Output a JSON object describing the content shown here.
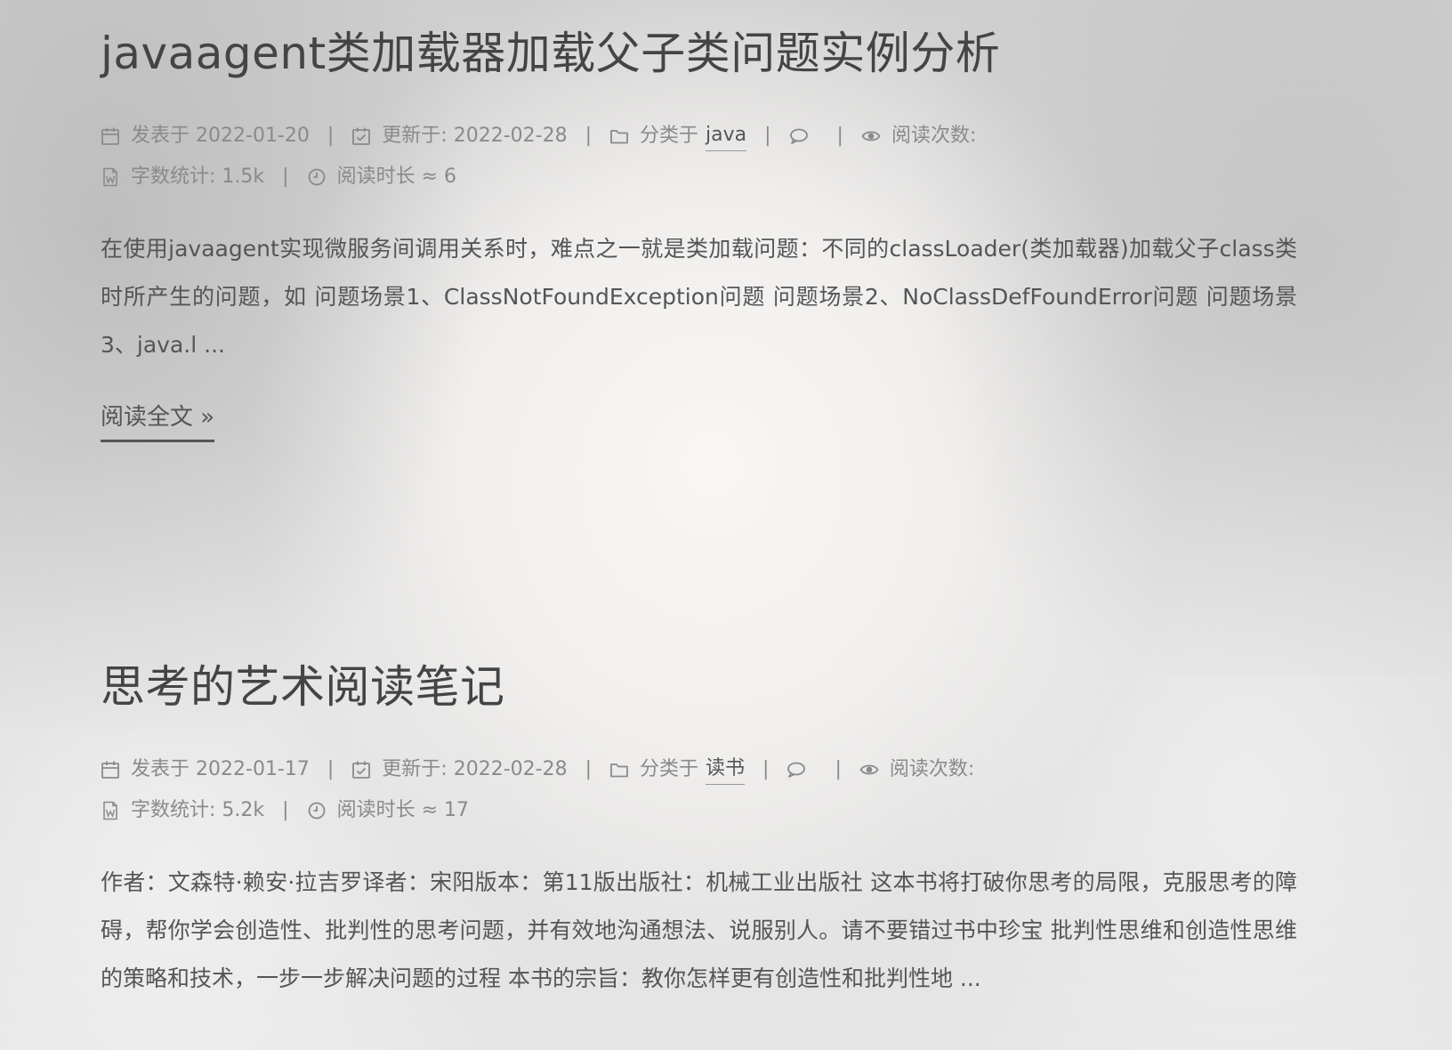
{
  "posts": [
    {
      "title": "javaagent类加载器加载父子类问题实例分析",
      "meta": {
        "posted_label": "发表于",
        "posted_date": "2022-01-20",
        "updated_label": "更新于:",
        "updated_date": "2022-02-28",
        "category_label": "分类于",
        "category": "java",
        "views_label": "阅读次数:",
        "wordcount_label": "字数统计:",
        "wordcount": "1.5k",
        "readtime_label": "阅读时长 ≈",
        "readtime": "6"
      },
      "excerpt": "在使用javaagent实现微服务间调用关系时，难点之一就是类加载问题：不同的classLoader(类加载器)加载父子class类时所产生的问题，如 问题场景1、ClassNotFoundException问题 问题场景2、NoClassDefFoundError问题 问题场景3、java.l ...",
      "read_more": "阅读全文 »"
    },
    {
      "title": "思考的艺术阅读笔记",
      "meta": {
        "posted_label": "发表于",
        "posted_date": "2022-01-17",
        "updated_label": "更新于:",
        "updated_date": "2022-02-28",
        "category_label": "分类于",
        "category": "读书",
        "views_label": "阅读次数:",
        "wordcount_label": "字数统计:",
        "wordcount": "5.2k",
        "readtime_label": "阅读时长 ≈",
        "readtime": "17"
      },
      "excerpt": "作者：文森特·赖安·拉吉罗译者：宋阳版本：第11版出版社：机械工业出版社 这本书将打破你思考的局限，克服思考的障碍，帮你学会创造性、批判性的思考问题，并有效地沟通想法、说服别人。请不要错过书中珍宝 批判性思维和创造性思维的策略和技术，一步一步解决问题的过程 本书的宗旨：教你怎样更有创造性和批判性地 ..."
    }
  ],
  "icons": {
    "posted": "calendar-icon",
    "updated": "calendar-check-icon",
    "category": "folder-icon",
    "comments": "comment-icon",
    "views": "eye-icon",
    "wordcount": "file-word-icon",
    "readtime": "clock-icon"
  }
}
